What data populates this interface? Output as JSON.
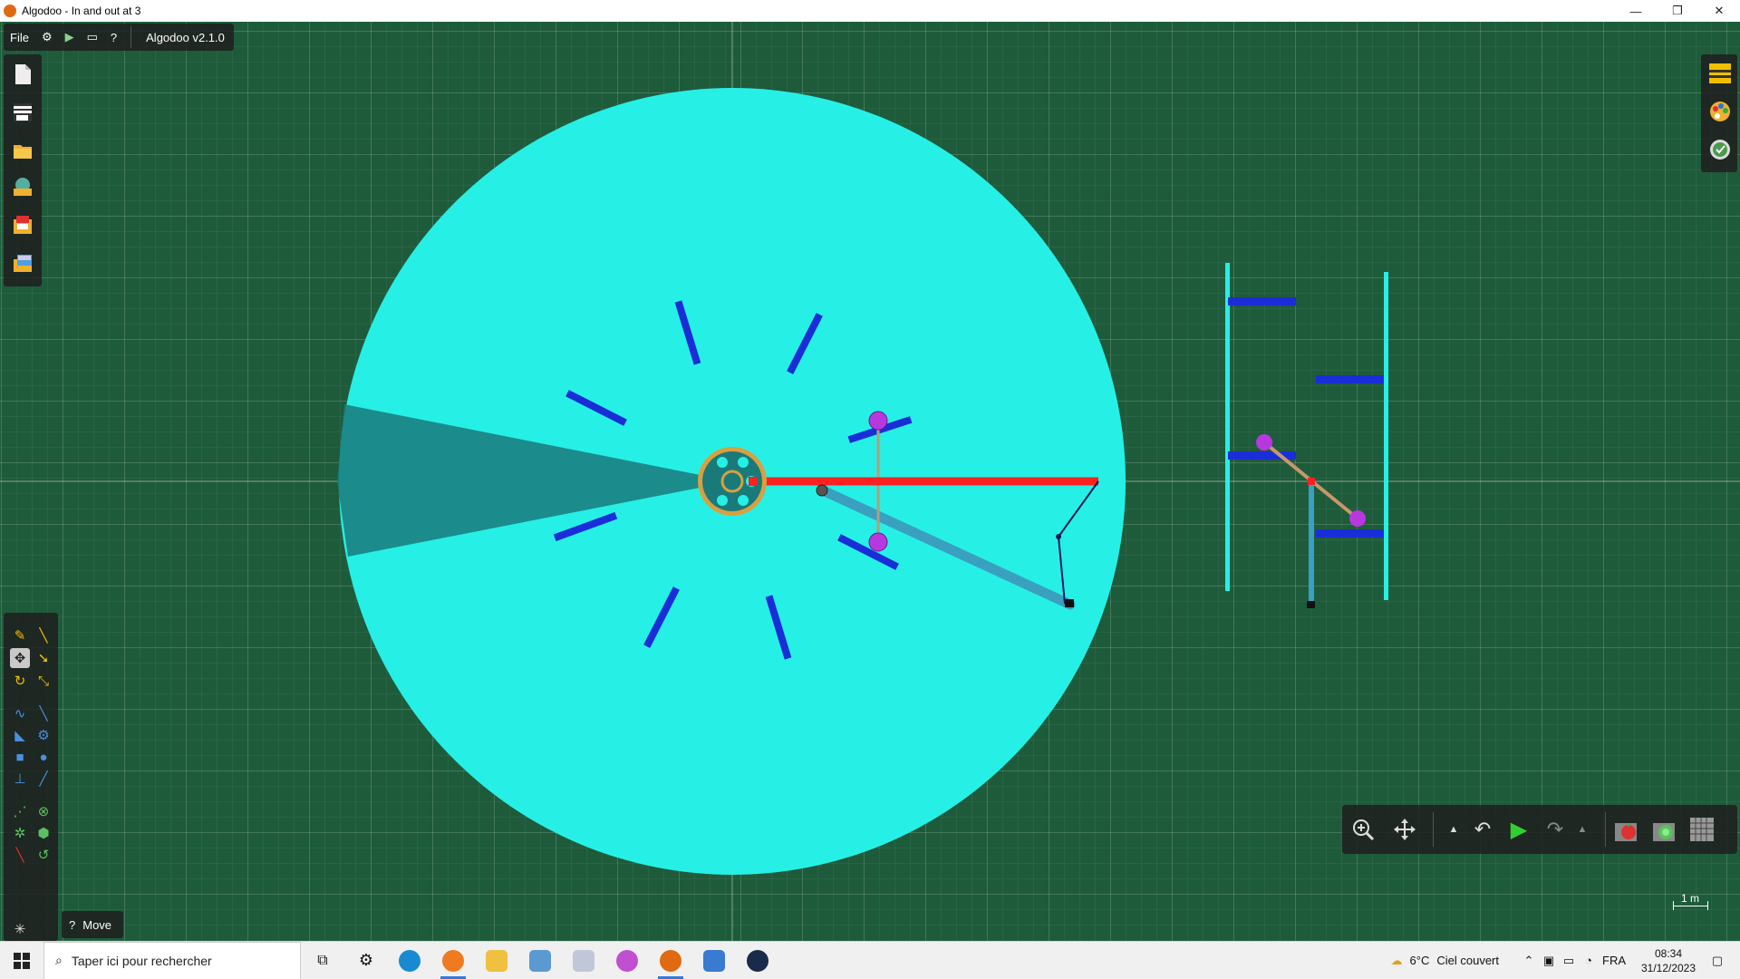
{
  "window": {
    "title": "Algodoo - In and out at 3",
    "minimize": "—",
    "restore": "❐",
    "close": "✕"
  },
  "menu": {
    "file_label": "File",
    "settings_icon": "⚙",
    "play_icon": "▶",
    "window_icon": "▭",
    "help_icon": "?",
    "version": "Algodoo v2.1.0"
  },
  "filebar_icons": [
    "new-scene-icon",
    "clear-icon",
    "open-folder-icon",
    "algobox-icon",
    "save-icon",
    "folder-images-icon"
  ],
  "tools": {
    "hint_icon": "?",
    "hint_label": "Move"
  },
  "controls": {
    "zoom_icon": "zoom-icon",
    "pan_icon": "pan-icon",
    "up_arrow": "▲",
    "undo_icon": "↶",
    "play_icon": "▶",
    "redo_icon": "↷",
    "more_arrow": "▲",
    "scale_label": "1 m"
  },
  "taskbar": {
    "search_placeholder": "Taper ici pour rechercher",
    "apps": [
      "task-view",
      "settings",
      "edge",
      "firefox",
      "file-explorer",
      "app-blue",
      "app-chart",
      "app-flame",
      "algodoo",
      "app-window",
      "app-c"
    ],
    "weather_temp": "6°C",
    "weather_desc": "Ciel couvert",
    "language": "FRA",
    "time": "08:34",
    "date": "31/12/2023"
  },
  "colors": {
    "background": "#1e5b3b",
    "wheel": "#26f0e6",
    "beam": "#ff2020",
    "paddle": "#1a2ed8",
    "ball": "#b838e0"
  }
}
